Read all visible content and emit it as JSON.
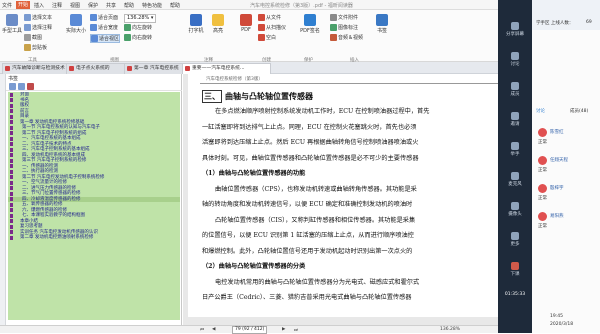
{
  "menu": {
    "items": [
      "文件",
      "开始",
      "插入",
      "注释",
      "视图",
      "保护",
      "共享",
      "帮助",
      "特色功能",
      "帮助"
    ],
    "active_index": 1,
    "title": "汽车电控系统检修（第3版）.pdf - 福昕阅读器"
  },
  "ribbon": {
    "tools": {
      "hand": "手型工具",
      "select_text": "选择文本",
      "select_annotation": "选择注释",
      "snapshot": "截图",
      "clipboard": "剪贴板",
      "group_label": "工具"
    },
    "view": {
      "actual_size": "实际大小",
      "fit_page": "适合页面",
      "fit_width": "适合宽度",
      "fit_visible": "适合视区",
      "rotate_left": "向左旋转",
      "rotate_right": "向右旋转",
      "zoom_value": "136.28%",
      "group_label": "视图"
    },
    "comment": {
      "typewriter": "打字机",
      "highlight": "高亮",
      "group_label": "注释"
    },
    "create": {
      "from_file": "从文件",
      "from_scanner": "从扫描仪",
      "blank": "空白",
      "pdf": "PDF",
      "group_label": "创建"
    },
    "protect": {
      "sign": "PDF签名",
      "group_label": "保护"
    },
    "links": {
      "file_attachment": "文件附件",
      "image_annotation": "图像标注",
      "audio_video": "音频＆视频",
      "bookmark": "书签",
      "group_label": "插入"
    }
  },
  "tabs": [
    {
      "label": "汽车故障诊断与检测技术"
    },
    {
      "label": "电子点火系统的"
    },
    {
      "label": "第一章 汽车电控系统"
    },
    {
      "label": "重要——汽车电控系统..."
    }
  ],
  "sidebar": {
    "title": "书签",
    "toc": [
      {
        "label": "封面",
        "sub": false
      },
      {
        "label": "书名",
        "sub": false
      },
      {
        "label": "版权",
        "sub": false
      },
      {
        "label": "前言",
        "sub": false
      },
      {
        "label": "目录",
        "sub": false
      },
      {
        "label": "第一章  发动机电控系统检修基础",
        "sub": false
      },
      {
        "label": "第一节  汽车电控系统的认知与汽车电子",
        "sub": true
      },
      {
        "label": "第二节  汽车电子控制系统的组成",
        "sub": true
      },
      {
        "label": "一、汽车电控系统的基本组成",
        "sub": true
      },
      {
        "label": "二、汽车电子技术的特点",
        "sub": true
      },
      {
        "label": "三、汽车电子控制系统的基本组成",
        "sub": true
      },
      {
        "label": "四、发动机电控系统的基本组成",
        "sub": true
      },
      {
        "label": "第三节  汽车电子控制系统的检修",
        "sub": true
      },
      {
        "label": "一、传感器的检测",
        "sub": true
      },
      {
        "label": "二、执行器的检测",
        "sub": true
      },
      {
        "label": "第二节  汽车电控发动机电子控制系统检修",
        "sub": true
      },
      {
        "label": "一、空气流量计的检修",
        "sub": true
      },
      {
        "label": "二、进气压力传感器的检修",
        "sub": true
      },
      {
        "label": "三、节气门位置传感器的检修",
        "sub": true
      },
      {
        "label": "四、冷却液温度传感器的检修",
        "sub": true
      },
      {
        "label": "五、氧传感器的检修",
        "sub": true
      },
      {
        "label": "六、爆燃传感器的检修",
        "sub": true
      },
      {
        "label": "七、本课程实验教学的结构框图",
        "sub": true
      },
      {
        "label": "本章小结",
        "sub": false
      },
      {
        "label": "复习思考题",
        "sub": false
      },
      {
        "label": "实训任务  汽车电控发动机传感器的认识",
        "sub": false
      },
      {
        "label": "第二章  发动机电控燃油喷射系统检修",
        "sub": false
      }
    ],
    "selected_index": 19
  },
  "document": {
    "running_header": "汽车电控系统检修（第3版）",
    "section_no": "三、",
    "section_title": "曲轴与凸轮轴位置传感器",
    "lines": [
      {
        "text": "在多点燃油顺序喷射控制系统发动机工作时，ECU 在控制喷油器过程中，首先",
        "bold": false
      },
      {
        "text": "一缸活塞即将到达排气上止点。同理，ECU 在控制火花塞跳火时，首先也必须",
        "bold": false
      },
      {
        "text": "活塞即将到达压缩上止点。然后 ECU 再根据曲轴转角信号控制喷油器喷油或火",
        "bold": false
      },
      {
        "text": "具体时刻。可见，曲轴位置传感器和凸轮轴位置传感器是必不可少的主要传感器",
        "bold": false
      },
      {
        "text": "（1）曲轴与凸轮轴位置传感器的功能",
        "bold": true
      },
      {
        "text": "曲轴位置传感器（CPS），也称发动机转速或曲轴转角传感器。其功能是采",
        "bold": false
      },
      {
        "text": "轴的转动角度和发动机转速信号，以便 ECU 确定和准确控制发动机的喷油时",
        "bold": false
      },
      {
        "text": "凸轮轴位置传感器（CIS），又称判缸传感器和相位传感器。其功能是采集",
        "bold": false
      },
      {
        "text": "的位置信号，以便 ECU 识别第 1 缸活塞的压缩上止点，从而进行顺序喷油控",
        "bold": false
      },
      {
        "text": "和爆燃控制。此外，凸轮轴位置信号还用于发动机起动时识别出第一次点火的",
        "bold": false
      },
      {
        "text": "（2）曲轴与凸轮轴位置传感器的分类",
        "bold": true
      },
      {
        "text": "电控发动机常用的曲轴与凸轮轴位置传感器分为光电式、磁感应式和霍尔式",
        "bold": false
      },
      {
        "text": "日产公爵王（Cedric）、三菱、猎豹吉普采用光电式曲轴与凸轮轴位置传感器",
        "bold": false
      }
    ]
  },
  "statusbar": {
    "page_indicator": "79 (92 / 412)",
    "zoom": "136.28%"
  },
  "meeting": {
    "sidebar_items": [
      "分享屏幕",
      "讨论",
      "成员",
      "邀请",
      "举手",
      "麦克风",
      "摄像头",
      "更多",
      "下课"
    ],
    "class_label": "学手区 上线人数：",
    "class_count": "69",
    "tabs": [
      "讨论",
      "成员(48)"
    ],
    "members": [
      {
        "name": "陈雪红",
        "status": "正常"
      },
      {
        "name": "任翔天程",
        "status": "正常"
      },
      {
        "name": "殷梓宇",
        "status": "正常"
      },
      {
        "name": "易阳燕",
        "status": "正常"
      }
    ],
    "timer": "01:35:33",
    "time": "19:45",
    "date": "2020/3/18",
    "colors": {
      "accent": "#e0613a",
      "panel_dark": "#1e2a3a",
      "toc_bg": "#bfe3a8",
      "member_red": "#e05050"
    }
  }
}
